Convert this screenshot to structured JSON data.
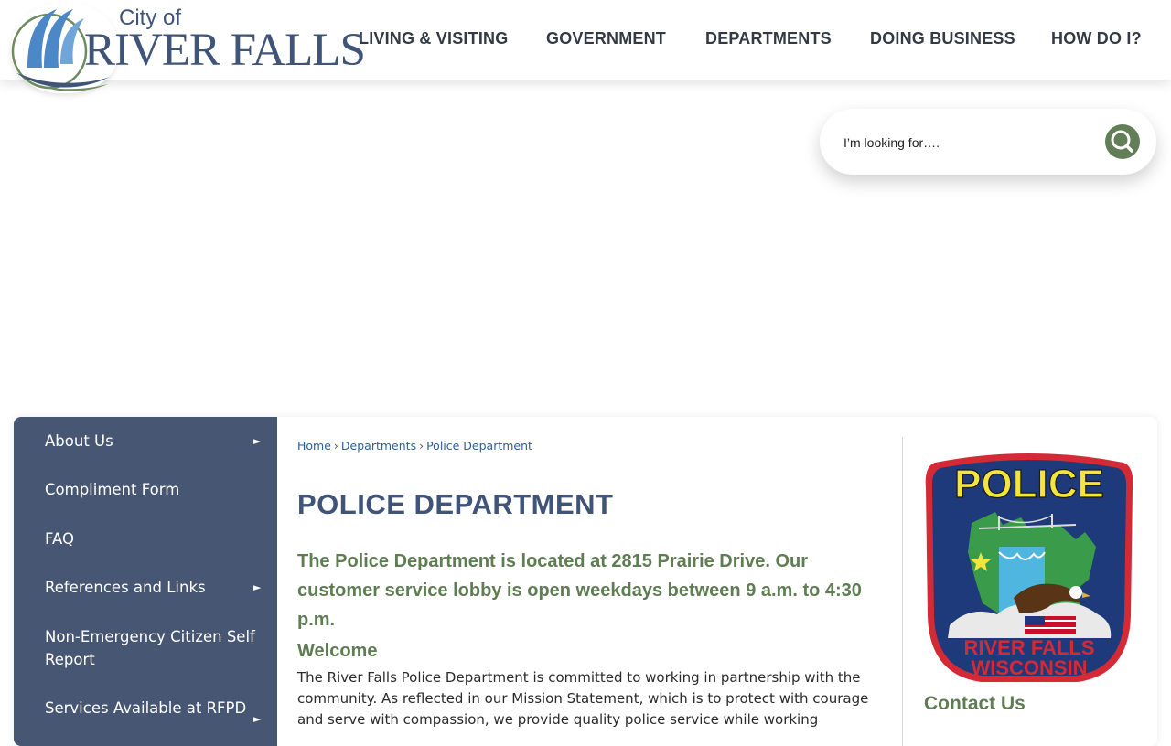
{
  "logo": {
    "city_of": "City of",
    "name": "RIVER FALLS"
  },
  "nav": {
    "items": [
      {
        "label": "LIVING & VISITING"
      },
      {
        "label": "GOVERNMENT"
      },
      {
        "label": "DEPARTMENTS"
      },
      {
        "label": "DOING BUSINESS"
      },
      {
        "label": "HOW DO I?"
      }
    ]
  },
  "search": {
    "placeholder": "I’m looking for….",
    "button_icon": "search-icon"
  },
  "sidebar": {
    "items": [
      {
        "label": "About Us",
        "has_arrow": true
      },
      {
        "label": "Compliment Form",
        "has_arrow": false
      },
      {
        "label": "FAQ",
        "has_arrow": false
      },
      {
        "label": "References and Links",
        "has_arrow": true
      },
      {
        "label": "Non-Emergency Citizen Self Report",
        "has_arrow": false
      },
      {
        "label": "Services Available at RFPD",
        "has_arrow": true
      }
    ],
    "arrow_glyph": "►"
  },
  "breadcrumb": {
    "items": [
      "Home",
      "Departments",
      "Police Department"
    ],
    "separator": "›"
  },
  "main": {
    "title": "POLICE DEPARTMENT",
    "intro": "The Police Department is located at 2815 Prairie Drive. Our customer service lobby is open weekdays between 9 a.m. to 4:30 p.m.",
    "welcome_heading": "Welcome",
    "body": "The River Falls Police Department is committed to working in partnership with the community. As reflected in our Mission Statement, which is to protect with courage and serve with compassion, we provide quality police service while working"
  },
  "aside": {
    "badge": {
      "top_text": "POLICE",
      "bottom_line1": "RIVER FALLS",
      "bottom_line2": "WISCONSIN"
    },
    "contact_heading": "Contact Us"
  },
  "colors": {
    "brand_blue": "#3f5478",
    "brand_green": "#5e7d52",
    "sidebar_bg": "#475672",
    "link_blue": "#2a5f9e",
    "badge_red": "#d42a36",
    "badge_navy": "#1f3a7a",
    "badge_yellow": "#f3e53d"
  }
}
